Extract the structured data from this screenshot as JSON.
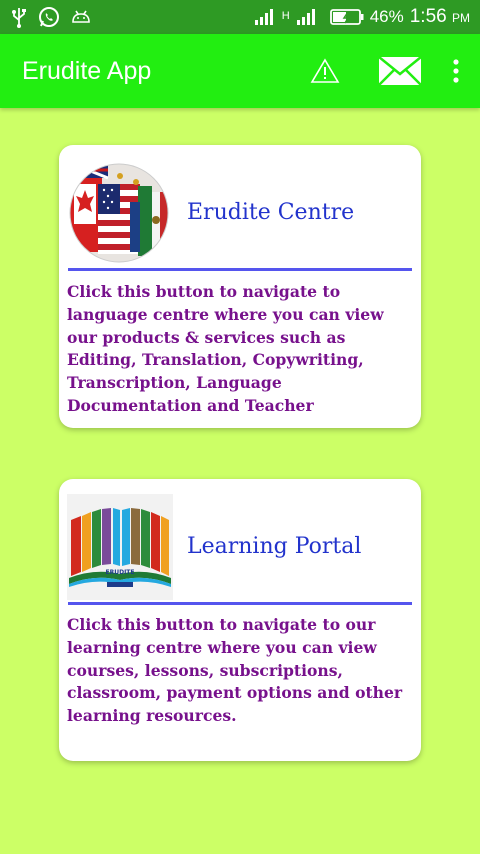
{
  "status_bar": {
    "battery_percent": "46%",
    "time": "1:56",
    "time_suffix": "PM",
    "network_label": "H",
    "icons": [
      "usb-icon",
      "whatsapp-icon",
      "android-icon",
      "signal-icon",
      "signal-icon",
      "battery-icon"
    ]
  },
  "appbar": {
    "title": "Erudite App",
    "actions": [
      "warning-icon",
      "mail-icon",
      "more-vertical-icon"
    ]
  },
  "cards": [
    {
      "title": "Erudite Centre",
      "description": "Click this button to navigate to language centre where you can view our products & services such as Editing, Translation, Copywriting, Transcription, Language Documentation and Teacher",
      "image": "flags-image"
    },
    {
      "title": "Learning Portal",
      "description": "Click this button to navigate to our learning centre where you can view courses, lessons, subscriptions, classroom, payment options and other learning resources.",
      "image": "erudite-logo-image",
      "logo_text": "ERUDITE"
    }
  ],
  "colors": {
    "background": "#ccff66",
    "appbar": "#22ee11",
    "statusbar": "#2e9a24",
    "title_text": "#2233cc",
    "body_text": "#77118c",
    "divider": "#5555ee"
  }
}
